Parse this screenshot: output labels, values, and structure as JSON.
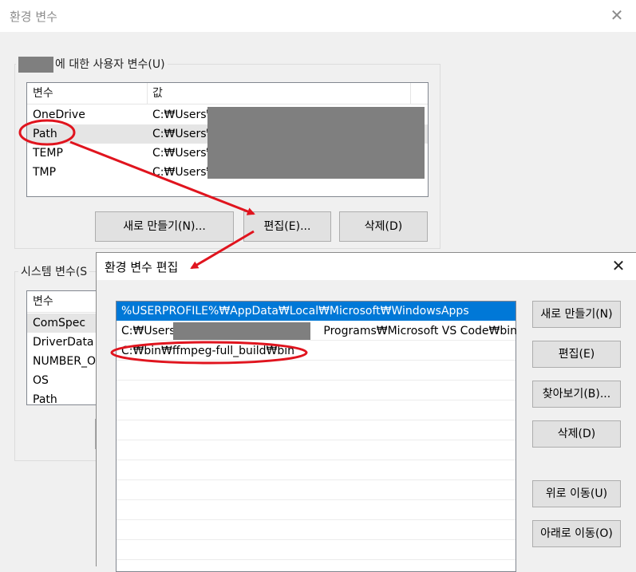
{
  "env_window": {
    "title": "환경 변수",
    "user_group_label": "에 대한 사용자 변수(U)",
    "user_vars": {
      "headers": [
        "변수",
        "값"
      ],
      "rows": [
        {
          "name": "OneDrive",
          "value": "C:₩Users₩"
        },
        {
          "name": "Path",
          "value": "C:₩Users₩"
        },
        {
          "name": "TEMP",
          "value": "C:₩Users₩"
        },
        {
          "name": "TMP",
          "value": "C:₩Users₩"
        }
      ],
      "selected_row": "Path"
    },
    "user_buttons": {
      "new": "새로 만들기(N)...",
      "edit": "편집(E)...",
      "delete": "삭제(D)"
    },
    "system_group_label": "시스템 변수(S",
    "system_vars": {
      "header": "변수",
      "rows": [
        "ComSpec",
        "DriverData",
        "NUMBER_O",
        "OS",
        "Path"
      ]
    }
  },
  "edit_dialog": {
    "title": "환경 변수 편집",
    "entries": [
      {
        "prefix": "%USERPROFILE%₩AppData₩Local₩Microsoft₩WindowsApps",
        "suffix": ""
      },
      {
        "prefix": "C:₩Users₩",
        "suffix": "Programs₩Microsoft VS Code₩bin"
      },
      {
        "prefix": "C:₩bin₩ffmpeg-full_build₩bin",
        "suffix": ""
      }
    ],
    "selected_index": 0,
    "buttons": {
      "new": "새로 만들기(N)",
      "edit": "편집(E)",
      "browse": "찾아보기(B)...",
      "delete": "삭제(D)",
      "move_up": "위로 이동(U)",
      "move_down": "아래로 이동(O)"
    }
  },
  "colors": {
    "selection_blue": "#0078d7",
    "annotation_red": "#e0141e",
    "redaction_gray": "#7f7f7f"
  }
}
